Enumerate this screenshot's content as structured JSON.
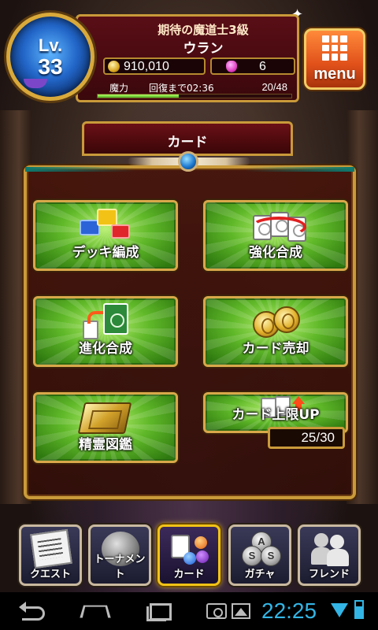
{
  "header": {
    "level_label": "Lv.",
    "level_value": "33",
    "rank_title": "期待の魔道士3級",
    "player_name": "ウラン",
    "coins": "910,010",
    "gems": "6",
    "mana_label": "魔力",
    "recovery_text": "回復まで02:36",
    "mana_count": "20/48",
    "mana_fraction": 0.42,
    "menu_label": "menu"
  },
  "section": {
    "title": "カード"
  },
  "card_menu": {
    "deck_edit": "デッキ編成",
    "enhance_fusion": "強化合成",
    "evolve_fusion": "進化合成",
    "sell_card": "カード売却",
    "spirit_book": "精霊図鑑",
    "limit_up": "カード上限UP",
    "card_count": "25/30"
  },
  "bottom_nav": {
    "quest": "クエスト",
    "tournament": "トーナメント",
    "card": "カード",
    "gacha": "ガチャ",
    "friend": "フレンド",
    "active": "card"
  },
  "system_bar": {
    "time": "22:25"
  },
  "colors": {
    "accent_gold": "#c99a3a",
    "button_green": "#5fb828",
    "header_red": "#5a0e16",
    "clock_blue": "#33b5e5"
  }
}
